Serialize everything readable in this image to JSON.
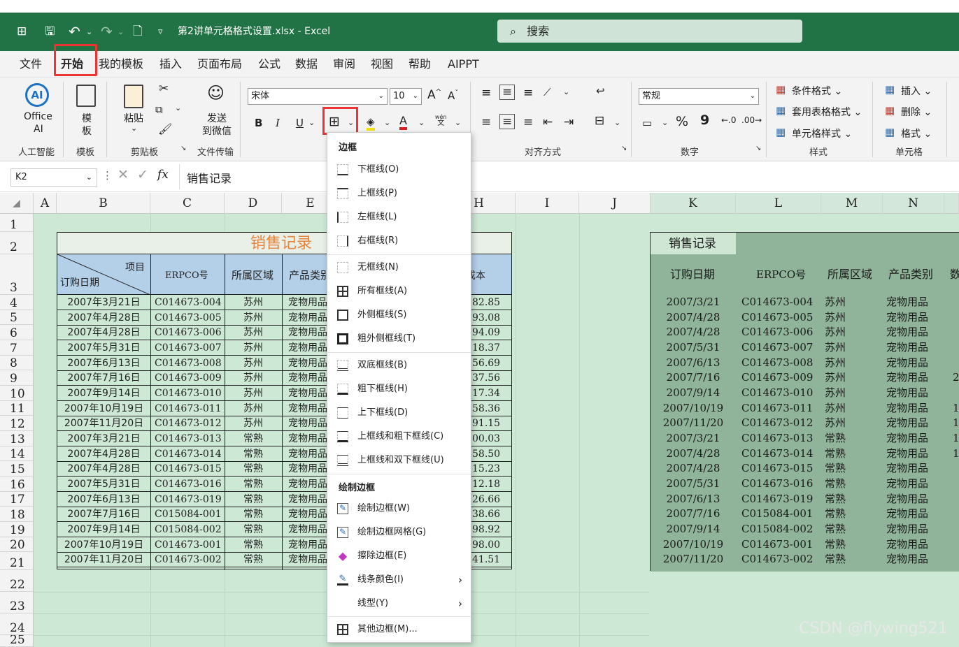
{
  "titlebar": {
    "filename": "第2讲单元格格式设置.xlsx",
    "sep": "-",
    "app": "Excel",
    "search_placeholder": "搜索",
    "qat_dropdown": "▿"
  },
  "tabs": [
    "文件",
    "开始",
    "我的模板",
    "插入",
    "页面布局",
    "公式",
    "数据",
    "审阅",
    "视图",
    "帮助",
    "AIPPT"
  ],
  "ribbon": {
    "ai": {
      "line1": "Office",
      "line2": "AI",
      "group": "人工智能"
    },
    "template": {
      "line1": "模",
      "line2": "板",
      "group": "模板"
    },
    "clipboard": {
      "paste": "粘贴",
      "group": "剪贴板"
    },
    "wechat": {
      "line1": "发送",
      "line2": "到微信",
      "group": "文件传输"
    },
    "font": {
      "name": "宋体",
      "size": "10",
      "bold": "B",
      "italic": "I",
      "underline": "U",
      "grow": "A^",
      "shrink": "Aˇ",
      "font_color": "A",
      "phonetic_top": "wén",
      "phonetic_bottom": "文"
    },
    "alignment": {
      "group": "对齐方式"
    },
    "number": {
      "format": "常规",
      "percent": "%",
      "comma": "9",
      "group": "数字"
    },
    "styles": {
      "cond": "条件格式",
      "table": "套用表格格式",
      "cell": "单元格样式",
      "group": "样式"
    },
    "cells": {
      "insert": "插入",
      "delete": "删除",
      "format": "格式",
      "group": "单元格"
    }
  },
  "formula": {
    "cellref": "K2",
    "fx": "fx",
    "content": "销售记录"
  },
  "columns": [
    "A",
    "B",
    "C",
    "D",
    "E",
    "H",
    "I",
    "J",
    "K",
    "L",
    "M",
    "N"
  ],
  "rows": [
    "1",
    "2",
    "3",
    "4",
    "5",
    "6",
    "7",
    "8",
    "9",
    "10",
    "11",
    "12",
    "13",
    "14",
    "15",
    "16",
    "17",
    "18",
    "19",
    "20",
    "21",
    "22",
    "23",
    "24",
    "25"
  ],
  "table1": {
    "title": "销售记录",
    "diag_top": "项目",
    "diag_bottom": "订购日期",
    "headers": [
      "ERPCO号",
      "所属区域",
      "产品类别",
      "成本"
    ],
    "rows": [
      [
        "2007年3月21日",
        "C014673-004",
        "苏州",
        "宠物用品",
        "82.85"
      ],
      [
        "2007年4月28日",
        "C014673-005",
        "苏州",
        "宠物用品",
        "93.08"
      ],
      [
        "2007年4月28日",
        "C014673-006",
        "苏州",
        "宠物用品",
        "94.09"
      ],
      [
        "2007年5月31日",
        "C014673-007",
        "苏州",
        "宠物用品",
        "18.37"
      ],
      [
        "2007年6月13日",
        "C014673-008",
        "苏州",
        "宠物用品",
        "56.69"
      ],
      [
        "2007年7月16日",
        "C014673-009",
        "苏州",
        "宠物用品",
        "37.56"
      ],
      [
        "2007年9月14日",
        "C014673-010",
        "苏州",
        "宠物用品",
        "17.34"
      ],
      [
        "2007年10月19日",
        "C014673-011",
        "苏州",
        "宠物用品",
        "58.36"
      ],
      [
        "2007年11月20日",
        "C014673-012",
        "苏州",
        "宠物用品",
        "91.15"
      ],
      [
        "2007年3月21日",
        "C014673-013",
        "常熟",
        "宠物用品",
        "00.03"
      ],
      [
        "2007年4月28日",
        "C014673-014",
        "常熟",
        "宠物用品",
        "58.50"
      ],
      [
        "2007年4月28日",
        "C014673-015",
        "常熟",
        "宠物用品",
        "15.23"
      ],
      [
        "2007年5月31日",
        "C014673-016",
        "常熟",
        "宠物用品",
        "12.18"
      ],
      [
        "2007年6月13日",
        "C014673-019",
        "常熟",
        "宠物用品",
        "26.66"
      ],
      [
        "2007年7月16日",
        "C015084-001",
        "常熟",
        "宠物用品",
        "38.66"
      ],
      [
        "2007年9月14日",
        "C015084-002",
        "常熟",
        "宠物用品",
        "98.92"
      ],
      [
        "2007年10月19日",
        "C014673-001",
        "常熟",
        "宠物用品",
        "98.00"
      ],
      [
        "2007年11月20日",
        "C014673-002",
        "常熟",
        "宠物用品",
        "41.51"
      ]
    ]
  },
  "table2": {
    "title": "销售记录",
    "headers": [
      "订购日期",
      "ERPCO号",
      "所属区域",
      "产品类别",
      "数"
    ],
    "rows": [
      [
        "2007/3/21",
        "C014673-004",
        "苏州",
        "宠物用品",
        ""
      ],
      [
        "2007/4/28",
        "C014673-005",
        "苏州",
        "宠物用品",
        ""
      ],
      [
        "2007/4/28",
        "C014673-006",
        "苏州",
        "宠物用品",
        ""
      ],
      [
        "2007/5/31",
        "C014673-007",
        "苏州",
        "宠物用品",
        ""
      ],
      [
        "2007/6/13",
        "C014673-008",
        "苏州",
        "宠物用品",
        ""
      ],
      [
        "2007/7/16",
        "C014673-009",
        "苏州",
        "宠物用品",
        "2"
      ],
      [
        "2007/9/14",
        "C014673-010",
        "苏州",
        "宠物用品",
        ""
      ],
      [
        "2007/10/19",
        "C014673-011",
        "苏州",
        "宠物用品",
        "1"
      ],
      [
        "2007/11/20",
        "C014673-012",
        "苏州",
        "宠物用品",
        "1"
      ],
      [
        "2007/3/21",
        "C014673-013",
        "常熟",
        "宠物用品",
        "1"
      ],
      [
        "2007/4/28",
        "C014673-014",
        "常熟",
        "宠物用品",
        "1"
      ],
      [
        "2007/4/28",
        "C014673-015",
        "常熟",
        "宠物用品",
        ""
      ],
      [
        "2007/5/31",
        "C014673-016",
        "常熟",
        "宠物用品",
        ""
      ],
      [
        "2007/6/13",
        "C014673-019",
        "常熟",
        "宠物用品",
        ""
      ],
      [
        "2007/7/16",
        "C015084-001",
        "常熟",
        "宠物用品",
        ""
      ],
      [
        "2007/9/14",
        "C015084-002",
        "常熟",
        "宠物用品",
        ""
      ],
      [
        "2007/10/19",
        "C014673-001",
        "常熟",
        "宠物用品",
        ""
      ],
      [
        "2007/11/20",
        "C014673-002",
        "常熟",
        "宠物用品",
        ""
      ]
    ]
  },
  "dropdown": {
    "header_border": "边框",
    "items1": [
      "下框线(O)",
      "上框线(P)",
      "左框线(L)",
      "右框线(R)"
    ],
    "items2": [
      "无框线(N)",
      "所有框线(A)",
      "外侧框线(S)",
      "粗外侧框线(T)"
    ],
    "items3": [
      "双底框线(B)",
      "粗下框线(H)",
      "上下框线(D)",
      "上框线和粗下框线(C)",
      "上框线和双下框线(U)"
    ],
    "header_draw": "绘制边框",
    "items4": [
      "绘制边框(W)",
      "绘制边框网格(G)",
      "擦除边框(E)",
      "线条颜色(I)",
      "线型(Y)"
    ],
    "items5": [
      "其他边框(M)..."
    ]
  },
  "colors": {
    "excel_green": "#217346",
    "sheet_bg": "#cde8d4",
    "table1_header": "#b4cfe8",
    "table1_title": "#e8833a",
    "table2_bg": "#8fb49a",
    "highlight": "#e33333"
  },
  "watermark": "CSDN @flywing521"
}
